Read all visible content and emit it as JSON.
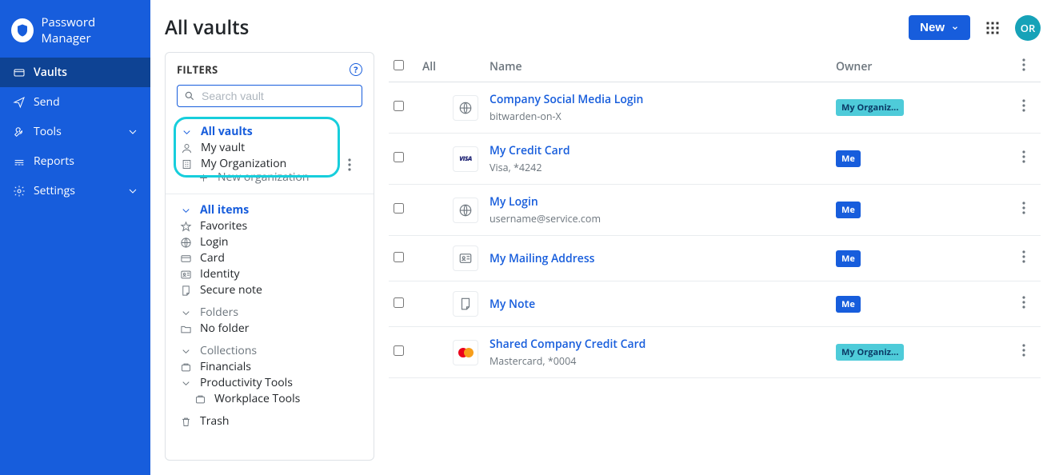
{
  "brand": {
    "title": "Password Manager"
  },
  "nav": {
    "vaults": "Vaults",
    "send": "Send",
    "tools": "Tools",
    "reports": "Reports",
    "settings": "Settings"
  },
  "header": {
    "title": "All vaults",
    "newLabel": "New",
    "avatar": "OR"
  },
  "filters": {
    "heading": "FILTERS",
    "searchPlaceholder": "Search vault",
    "allVaults": "All vaults",
    "myVault": "My vault",
    "myOrg": "My Organization",
    "newOrg": "New organization",
    "allItems": "All items",
    "favorites": "Favorites",
    "login": "Login",
    "card": "Card",
    "identity": "Identity",
    "secureNote": "Secure note",
    "folders": "Folders",
    "noFolder": "No folder",
    "collections": "Collections",
    "financials": "Financials",
    "productivity": "Productivity Tools",
    "workplace": "Workplace Tools",
    "trash": "Trash"
  },
  "table": {
    "colAll": "All",
    "colName": "Name",
    "colOwner": "Owner"
  },
  "items": [
    {
      "name": "Company Social Media Login",
      "sub": "bitwarden-on-X",
      "owner": "My Organiz...",
      "ownerType": "org",
      "icon": "globe"
    },
    {
      "name": "My Credit Card",
      "sub": "Visa, *4242",
      "owner": "Me",
      "ownerType": "me",
      "icon": "visa"
    },
    {
      "name": "My Login",
      "sub": "username@service.com",
      "owner": "Me",
      "ownerType": "me",
      "icon": "globe"
    },
    {
      "name": "My Mailing Address",
      "sub": "",
      "owner": "Me",
      "ownerType": "me",
      "icon": "identity"
    },
    {
      "name": "My Note",
      "sub": "",
      "owner": "Me",
      "ownerType": "me",
      "icon": "note"
    },
    {
      "name": "Shared Company Credit Card",
      "sub": "Mastercard, *0004",
      "owner": "My Organiz...",
      "ownerType": "org",
      "icon": "mc"
    }
  ]
}
